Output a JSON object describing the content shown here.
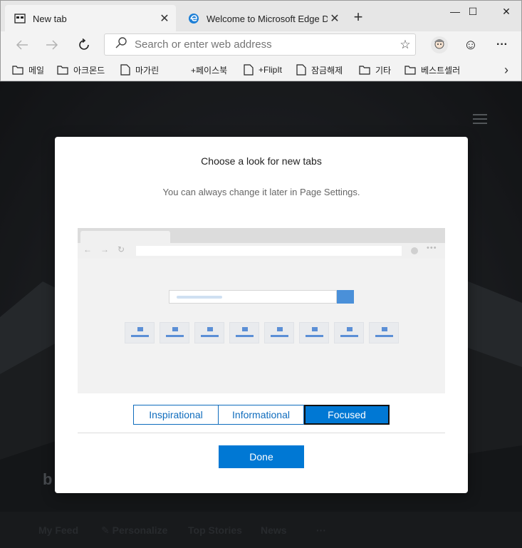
{
  "tabs": [
    {
      "title": "New tab",
      "active": true,
      "close": "✕"
    },
    {
      "title": "Welcome to Microsoft Edge Dev",
      "active": false,
      "close": "✕"
    }
  ],
  "window_controls": {
    "new_tab": "+",
    "minimize": "—",
    "maximize": "☐",
    "close": "✕"
  },
  "toolbar": {
    "search_placeholder": "Search or enter web address",
    "favorite_glyph": "☆",
    "emoji_glyph": "☺",
    "more_glyph": "···"
  },
  "bookmarks": [
    {
      "label": "메일",
      "icon": "folder-icon"
    },
    {
      "label": "아크몬드",
      "icon": "folder-icon"
    },
    {
      "label": "마가린",
      "icon": "page-icon"
    },
    {
      "label": "+페이스북",
      "icon": "page-icon"
    },
    {
      "label": "+FlipIt",
      "icon": "page-icon"
    },
    {
      "label": "잠금해제",
      "icon": "page-icon"
    },
    {
      "label": "기타",
      "icon": "folder-icon"
    },
    {
      "label": "베스트셀러",
      "icon": "folder-icon"
    }
  ],
  "bookmarks_more": "›",
  "feed": {
    "items": [
      "My Feed",
      "Personalize",
      "Top Stories",
      "News",
      "···"
    ],
    "logo": "b"
  },
  "dialog": {
    "title": "Choose a look for new tabs",
    "subtitle": "You can always change it later in Page Settings.",
    "options": [
      "Inspirational",
      "Informational",
      "Focused"
    ],
    "selected": "Focused",
    "done_label": "Done"
  },
  "colors": {
    "accent": "#0078d4",
    "link": "#0f6cbd"
  }
}
